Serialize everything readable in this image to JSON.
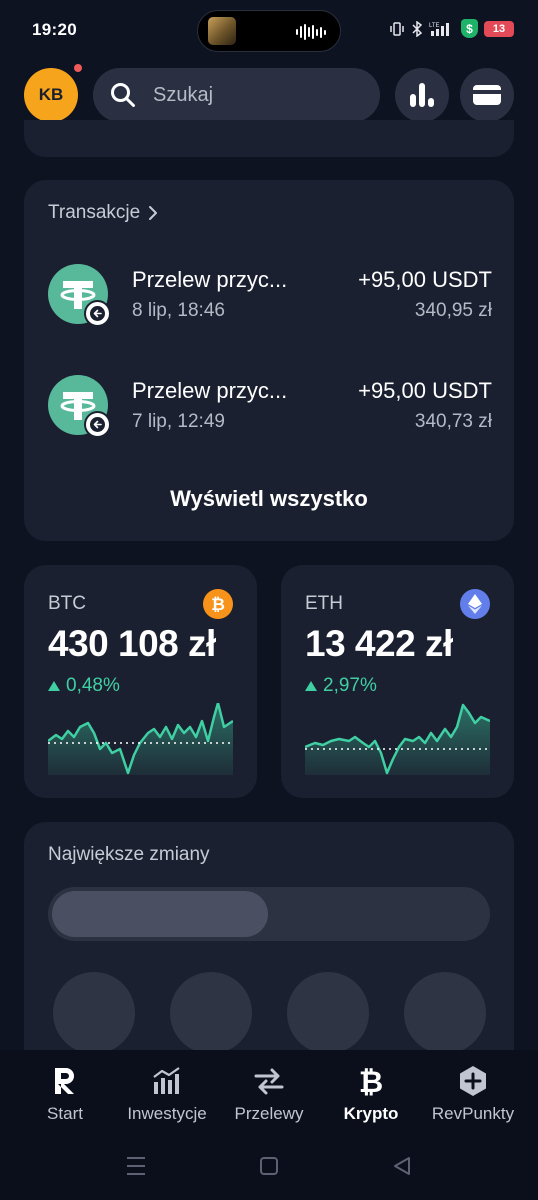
{
  "status_bar": {
    "time": "19:20",
    "icons": [
      "vibrate-icon",
      "bluetooth-icon",
      "lte-signal-icon",
      "shield-icon"
    ],
    "shield_symbol": "$",
    "battery": "13",
    "battery_color": "#e24a57"
  },
  "header": {
    "avatar_initials": "KB",
    "avatar_color": "#f5a41c",
    "search_placeholder": "Szukaj",
    "buttons": [
      "analytics-icon",
      "card-icon"
    ]
  },
  "transactions": {
    "title": "Transakcje",
    "items": [
      {
        "title": "Przelew przyc...",
        "date": "8 lip, 18:46",
        "amount": "+95,00 USDT",
        "fiat": "340,95 zł",
        "icon": "tether-icon"
      },
      {
        "title": "Przelew przyc...",
        "date": "7 lip, 12:49",
        "amount": "+95,00 USDT",
        "fiat": "340,73 zł",
        "icon": "tether-icon"
      }
    ],
    "view_all": "Wyświetl wszystko"
  },
  "coins": [
    {
      "symbol": "BTC",
      "price": "430 108 zł",
      "change": "0,48%",
      "trend": "up",
      "logo": "bitcoin-icon",
      "logo_color": "#f7931a"
    },
    {
      "symbol": "ETH",
      "price": "13 422 zł",
      "change": "2,97%",
      "trend": "up",
      "logo": "ethereum-icon",
      "logo_color": "#627eea"
    }
  ],
  "movers": {
    "title": "Największe zmiany"
  },
  "bottom_nav": {
    "items": [
      {
        "label": "Start",
        "icon": "revolut-logo-icon"
      },
      {
        "label": "Inwestycje",
        "icon": "chart-icon"
      },
      {
        "label": "Przelewy",
        "icon": "transfer-arrows-icon"
      },
      {
        "label": "Krypto",
        "icon": "bitcoin-icon",
        "active": true
      },
      {
        "label": "RevPunkty",
        "icon": "revpoints-icon"
      }
    ]
  },
  "accent_color": "#3fcfa3"
}
